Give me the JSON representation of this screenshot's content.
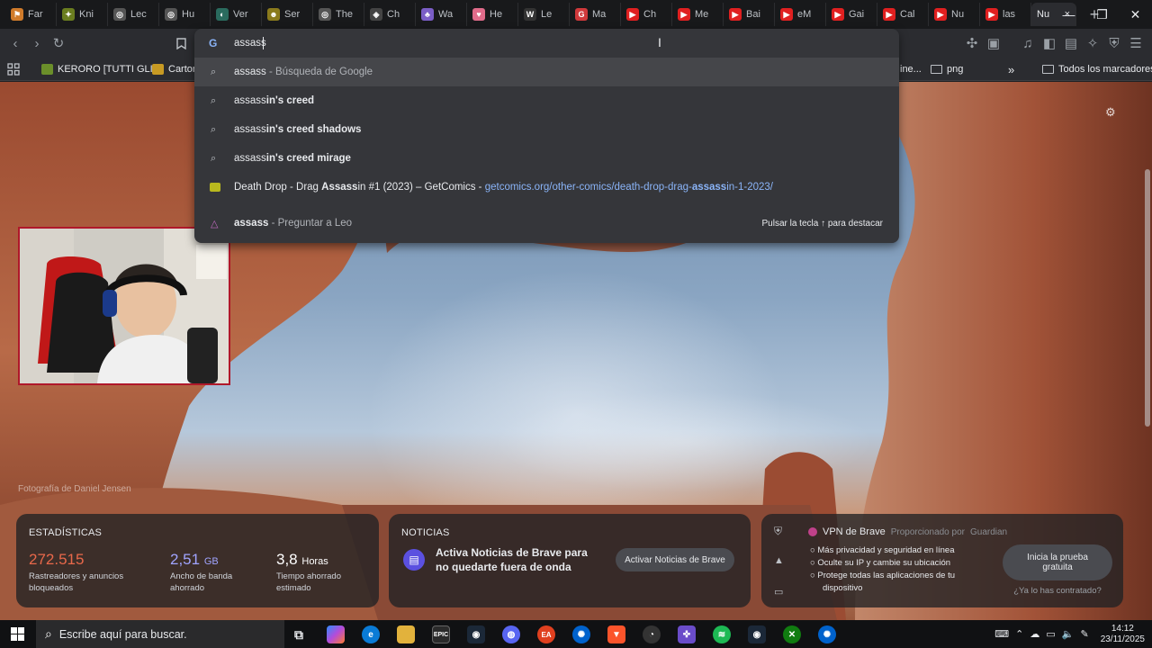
{
  "tabs": [
    {
      "label": "Far",
      "color": "#d07b2b",
      "glyph": "⚑"
    },
    {
      "label": "Kni",
      "color": "#6a7d1f",
      "glyph": "✦"
    },
    {
      "label": "Lec",
      "color": "#555",
      "glyph": "◎"
    },
    {
      "label": "Hu",
      "color": "#555",
      "glyph": "◎"
    },
    {
      "label": "Ver",
      "color": "#2a6b5e",
      "glyph": "◐"
    },
    {
      "label": "Ser",
      "color": "#8a7a1c",
      "glyph": "☻"
    },
    {
      "label": "The",
      "color": "#555",
      "glyph": "◎"
    },
    {
      "label": "Ch",
      "color": "#444",
      "glyph": "◈"
    },
    {
      "label": "Wa",
      "color": "#7b5ec7",
      "glyph": "♣"
    },
    {
      "label": "He",
      "color": "#e06b8a",
      "glyph": "♥"
    },
    {
      "label": "Le",
      "color": "#333",
      "glyph": "W"
    },
    {
      "label": "Ma",
      "color": "#d0393b",
      "glyph": "G"
    },
    {
      "label": "Ch",
      "color": "#e02020",
      "glyph": "▶"
    },
    {
      "label": "Me",
      "color": "#e02020",
      "glyph": "▶"
    },
    {
      "label": "Bai",
      "color": "#e02020",
      "glyph": "▶"
    },
    {
      "label": "eM",
      "color": "#e02020",
      "glyph": "▶"
    },
    {
      "label": "Gai",
      "color": "#e02020",
      "glyph": "▶"
    },
    {
      "label": "Cal",
      "color": "#e02020",
      "glyph": "▶"
    },
    {
      "label": "Nu",
      "color": "#e02020",
      "glyph": "▶"
    },
    {
      "label": "las",
      "color": "#e02020",
      "glyph": "▶"
    }
  ],
  "active_tab": {
    "label": "Nu",
    "close": "×"
  },
  "new_tab": "+",
  "window": {
    "minimize": "—",
    "maximize": "❐",
    "close": "✕"
  },
  "omnibox": {
    "query": "assass",
    "suggestions": [
      {
        "icon": "search-icon",
        "prefix": "assass",
        "bold": "",
        "suffix": " - Búsqueda de Google"
      },
      {
        "icon": "search-icon",
        "prefix": "assass",
        "bold": "in's creed",
        "suffix": ""
      },
      {
        "icon": "search-icon",
        "prefix": "assass",
        "bold": "in's creed shadows",
        "suffix": ""
      },
      {
        "icon": "search-icon",
        "prefix": "assass",
        "bold": "in's creed mirage",
        "suffix": ""
      }
    ],
    "history": {
      "title_pre": "Death Drop - Drag ",
      "title_bold": "Assass",
      "title_post": "in #1 (2023) – GetComics - ",
      "url_pre": "getcomics.org/other-comics/death-drop-drag-",
      "url_bold": "assass",
      "url_post": "in-1-2023/"
    },
    "leo": {
      "query": "assass",
      "suffix": " - Preguntar a Leo",
      "hint": "Pulsar la tecla ↑ para destacar"
    }
  },
  "bookmarks": {
    "items": [
      "KERORO [TUTTI GLI...",
      "Carton"
    ],
    "right": [
      "ine...",
      "png"
    ],
    "more": "»",
    "all": "Todos los marcadores"
  },
  "page": {
    "photo_credit": "Fotografía de Daniel Jensen",
    "stats": {
      "title": "ESTADÍSTICAS",
      "trackers": {
        "value": "272.515",
        "desc": "Rastreadores y anuncios bloqueados"
      },
      "bandwidth": {
        "value": "2,51",
        "unit": "GB",
        "desc": "Ancho de banda ahorrado"
      },
      "time": {
        "value": "3,8",
        "unit": "Horas",
        "desc": "Tiempo ahorrado estimado"
      }
    },
    "news": {
      "title": "NOTICIAS",
      "text": "Activa Noticias de Brave para no quedarte fuera de onda",
      "button": "Activar Noticias de Brave"
    },
    "vpn": {
      "title": "VPN de Brave",
      "sponsor": "Proporcionado por",
      "sponsor_name": "Guardian",
      "features": [
        "Más privacidad y seguridad en línea",
        "Oculte su IP y cambie su ubicación",
        "Protege todas las aplicaciones de tu dispositivo"
      ],
      "button": "Inicia la prueba gratuita",
      "link": "¿Ya lo has contratado?"
    }
  },
  "taskbar": {
    "search_placeholder": "Escribe aquí para buscar.",
    "time": "14:12",
    "date": "23/11/2025"
  },
  "colors": {
    "accent": "#8ab4f8",
    "stat_orange": "#e8684a",
    "stat_purple": "#a0a4ff",
    "webcam_border": "#b0182a"
  }
}
